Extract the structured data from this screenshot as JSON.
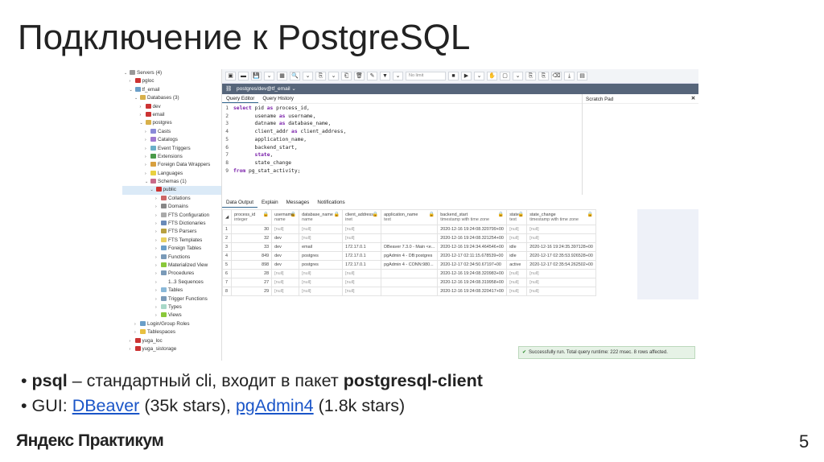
{
  "slide": {
    "title": "Подключение к PostgreSQL",
    "page_number": "5",
    "logo": "Яндекс Практикум",
    "bullets": [
      {
        "b1": "psql",
        "t1": " – стандартный cli, входит в пакет ",
        "b2": "postgresql-client"
      },
      {
        "t1": "GUI: ",
        "link1": "DBeaver",
        "t2": " (35k stars), ",
        "link2": "pgAdmin4",
        "t3": " (1.8k stars)"
      }
    ]
  },
  "tree": [
    {
      "label": "Servers (4)",
      "d": 0,
      "ar": "v",
      "c": "#999"
    },
    {
      "label": "pgloc",
      "d": 1,
      "ar": ">",
      "c": "#c33"
    },
    {
      "label": "tf_email",
      "d": 1,
      "ar": "v",
      "c": "#6a9ec8"
    },
    {
      "label": "Databases (3)",
      "d": 2,
      "ar": "v",
      "c": "#d8b04a"
    },
    {
      "label": "dev",
      "d": 3,
      "ar": ">",
      "c": "#c33"
    },
    {
      "label": "email",
      "d": 3,
      "ar": ">",
      "c": "#c33"
    },
    {
      "label": "postgres",
      "d": 3,
      "ar": "v",
      "c": "#d8b04a"
    },
    {
      "label": "Casts",
      "d": 4,
      "ar": ">",
      "c": "#8a8ad8"
    },
    {
      "label": "Catalogs",
      "d": 4,
      "ar": ">",
      "c": "#a07ad0"
    },
    {
      "label": "Event Triggers",
      "d": 4,
      "ar": ">",
      "c": "#6ab0c8"
    },
    {
      "label": "Extensions",
      "d": 4,
      "ar": ">",
      "c": "#4a9a4a"
    },
    {
      "label": "Foreign Data Wrappers",
      "d": 4,
      "ar": ">",
      "c": "#d8a040"
    },
    {
      "label": "Languages",
      "d": 4,
      "ar": ">",
      "c": "#e8d040"
    },
    {
      "label": "Schemas (1)",
      "d": 4,
      "ar": "v",
      "c": "#c86a8a"
    },
    {
      "label": "public",
      "d": 5,
      "ar": "v",
      "c": "#c33",
      "sel": true
    },
    {
      "label": "Collations",
      "d": 6,
      "ar": ">",
      "c": "#c66"
    },
    {
      "label": "Domains",
      "d": 6,
      "ar": ">",
      "c": "#888"
    },
    {
      "label": "FTS Configuration",
      "d": 6,
      "ar": ">",
      "c": "#aaa"
    },
    {
      "label": "FTS Dictionaries",
      "d": 6,
      "ar": ">",
      "c": "#6a8ab8"
    },
    {
      "label": "FTS Parsers",
      "d": 6,
      "ar": ">",
      "c": "#b8a040"
    },
    {
      "label": "FTS Templates",
      "d": 6,
      "ar": ">",
      "c": "#e8d060"
    },
    {
      "label": "Foreign Tables",
      "d": 6,
      "ar": ">",
      "c": "#6a9ec8"
    },
    {
      "label": "Functions",
      "d": 6,
      "ar": ">",
      "c": "#7a9ab8"
    },
    {
      "label": "Materialized View",
      "d": 6,
      "ar": ">",
      "c": "#8ac83a"
    },
    {
      "label": "Procedures",
      "d": 6,
      "ar": ">",
      "c": "#7a9ab8"
    },
    {
      "label": "1..3 Sequences",
      "d": 6,
      "ar": ">",
      "c": "#fff"
    },
    {
      "label": "Tables",
      "d": 6,
      "ar": ">",
      "c": "#8ab8d8"
    },
    {
      "label": "Trigger Functions",
      "d": 6,
      "ar": ">",
      "c": "#7a9ab8"
    },
    {
      "label": "Types",
      "d": 6,
      "ar": ">",
      "c": "#a8d8c8"
    },
    {
      "label": "Views",
      "d": 6,
      "ar": ">",
      "c": "#8ac83a"
    },
    {
      "label": "Login/Group Roles",
      "d": 2,
      "ar": ">",
      "c": "#6a9ec8"
    },
    {
      "label": "Tablespaces",
      "d": 2,
      "ar": ">",
      "c": "#e8c040"
    },
    {
      "label": "yuga_loc",
      "d": 1,
      "ar": ">",
      "c": "#c33"
    },
    {
      "label": "yuga_sistorage",
      "d": 1,
      "ar": ">",
      "c": "#c33"
    }
  ],
  "toolbar": {
    "limit": "No limit"
  },
  "connection": "postgres/dev@tf_email ⌄",
  "editor_tabs": [
    "Query Editor",
    "Query History"
  ],
  "scratch_pad": "Scratch Pad",
  "code": [
    {
      "n": "1",
      "kw": "select",
      "t": " pid ",
      "kw2": "as",
      "t2": " process_id,"
    },
    {
      "n": "2",
      "kw": "",
      "t": "       usename ",
      "kw2": "as",
      "t2": " username,"
    },
    {
      "n": "3",
      "kw": "",
      "t": "       datname ",
      "kw2": "as",
      "t2": " database_name,"
    },
    {
      "n": "4",
      "kw": "",
      "t": "       client_addr ",
      "kw2": "as",
      "t2": " client_address,"
    },
    {
      "n": "5",
      "kw": "",
      "t": "       application_name,",
      "kw2": "",
      "t2": ""
    },
    {
      "n": "6",
      "kw": "",
      "t": "       backend_start,",
      "kw2": "",
      "t2": ""
    },
    {
      "n": "7",
      "kw": "",
      "t": "       ",
      "kw2": "state",
      "t2": ","
    },
    {
      "n": "8",
      "kw": "",
      "t": "       state_change",
      "kw2": "",
      "t2": ""
    },
    {
      "n": "9",
      "kw": "from",
      "t": " pg_stat_activity;",
      "kw2": "",
      "t2": ""
    }
  ],
  "result_tabs": [
    "Data Output",
    "Explain",
    "Messages",
    "Notifications"
  ],
  "columns": [
    {
      "name": "process_id",
      "type": "integer"
    },
    {
      "name": "username",
      "type": "name"
    },
    {
      "name": "database_name",
      "type": "name"
    },
    {
      "name": "client_address",
      "type": "inet"
    },
    {
      "name": "application_name",
      "type": "text"
    },
    {
      "name": "backend_start",
      "type": "timestamp with time zone"
    },
    {
      "name": "state",
      "type": "text"
    },
    {
      "name": "state_change",
      "type": "timestamp with time zone"
    }
  ],
  "rows": [
    [
      "1",
      "30",
      "[null]",
      "[null]",
      "[null]",
      "",
      "2020-12-16 19:24:08.320799+00",
      "[null]",
      "[null]"
    ],
    [
      "2",
      "32",
      "dev",
      "[null]",
      "[null]",
      "",
      "2020-12-16 19:24:08.321254+00",
      "[null]",
      "[null]"
    ],
    [
      "3",
      "33",
      "dev",
      "email",
      "172.17.0.1",
      "DBeaver 7.3.0 - Main <e...",
      "2020-12-16 19:24:34.464546+00",
      "idle",
      "2020-12-16 19:24:35.397128+00"
    ],
    [
      "4",
      "849",
      "dev",
      "postgres",
      "172.17.0.1",
      "pgAdmin 4 - DB:postgres",
      "2020-12-17 02:11:15.678539+00",
      "idle",
      "2020-12-17 02:35:53.926528+00"
    ],
    [
      "5",
      "898",
      "dev",
      "postgres",
      "172.17.0.1",
      "pgAdmin 4 - CONN:980...",
      "2020-12-17 02:34:50.67197+00",
      "active",
      "2020-12-17 02:35:54.262502+00"
    ],
    [
      "6",
      "28",
      "[null]",
      "[null]",
      "[null]",
      "",
      "2020-12-16 19:24:08.320983+00",
      "[null]",
      "[null]"
    ],
    [
      "7",
      "27",
      "[null]",
      "[null]",
      "[null]",
      "",
      "2020-12-16 19:24:08.319958+00",
      "[null]",
      "[null]"
    ],
    [
      "8",
      "29",
      "[null]",
      "[null]",
      "[null]",
      "",
      "2020-12-16 19:24:08.320417+00",
      "[null]",
      "[null]"
    ]
  ],
  "status": "Successfully run. Total query runtime: 222 msec. 8 rows affected."
}
